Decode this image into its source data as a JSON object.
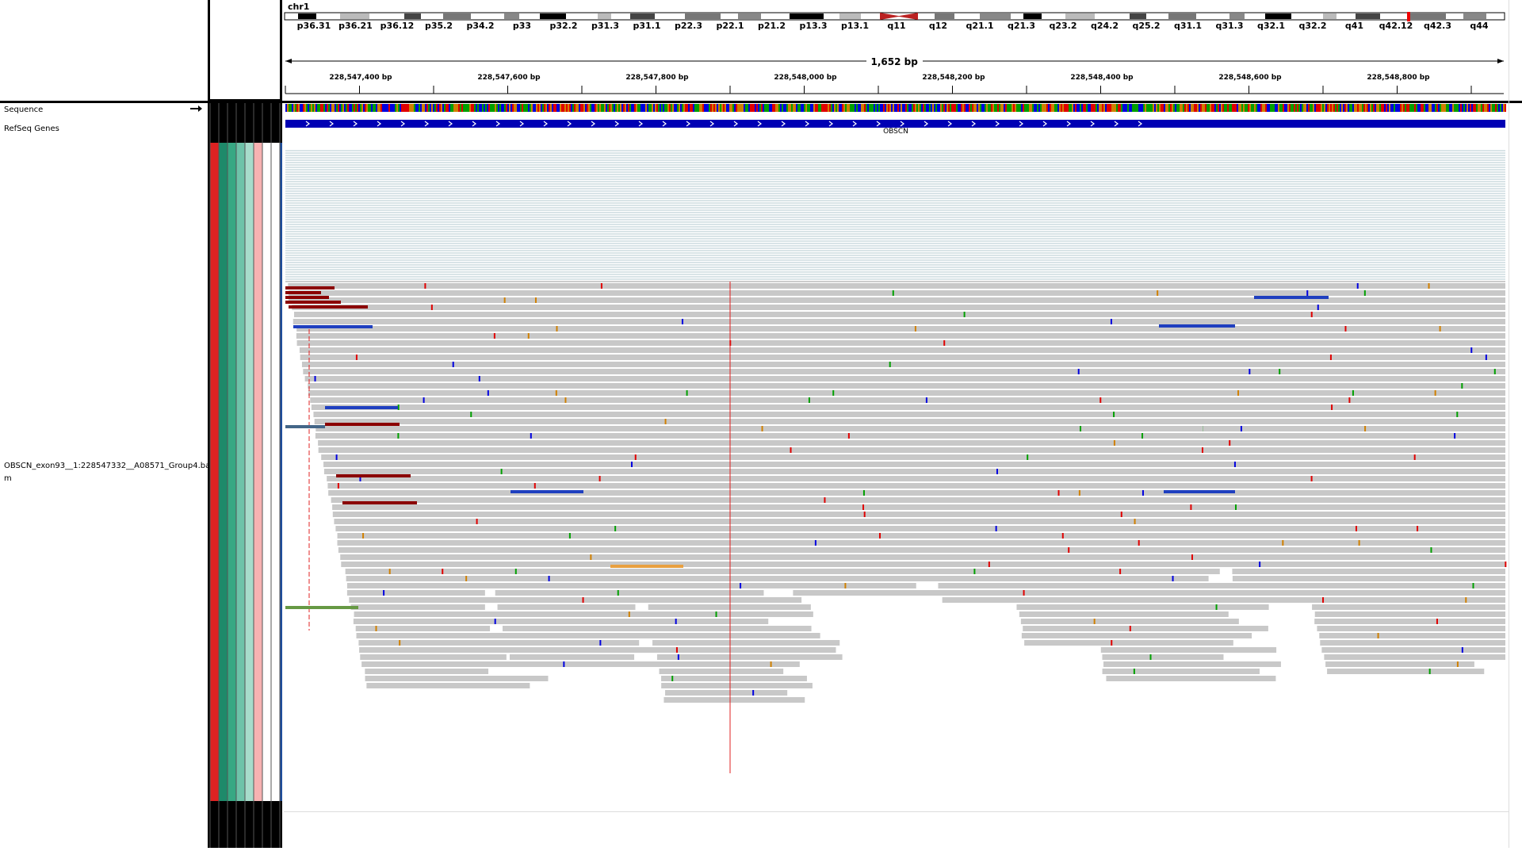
{
  "locus": {
    "chromosome": "chr1",
    "span_label": "1,652 bp"
  },
  "ideogram": {
    "bands": [
      "p36.31",
      "p36.21",
      "p36.12",
      "p35.2",
      "p34.2",
      "p33",
      "p32.2",
      "p31.3",
      "p31.1",
      "p22.3",
      "p22.1",
      "p21.2",
      "p13.3",
      "p13.1",
      "q11",
      "q12",
      "q21.1",
      "q21.3",
      "q23.2",
      "q24.2",
      "q25.2",
      "q31.1",
      "q31.3",
      "q32.1",
      "q32.2",
      "q41",
      "q42.12",
      "q42.3",
      "q44"
    ]
  },
  "ruler": {
    "ticks": [
      "228,547,400 bp",
      "228,547,600 bp",
      "228,547,800 bp",
      "228,548,000 bp",
      "228,548,200 bp",
      "228,548,400 bp",
      "228,548,600 bp",
      "228,548,800 bp"
    ]
  },
  "tracks": {
    "sequence": "Sequence",
    "refseq": "RefSeq Genes",
    "alignment_line1": "OBSCN_exon93__1:228547332__A08571_Group4.ba",
    "alignment_line2": "m"
  },
  "gene": {
    "name": "OBSCN"
  },
  "colors": {
    "gene": "#0000b4",
    "read": "#c8c8c8",
    "mismatch_line": "#e02020",
    "insert_large": "#8b0000",
    "insert_small": "#1f3fbf"
  },
  "attributes": {
    "colors": [
      "#dd2222",
      "#1e8a6a",
      "#37a883",
      "#6ec3a9",
      "#a7dccb",
      "#f7b2b2",
      "#ffffff",
      "#ffffff",
      "#1f4e9c"
    ]
  },
  "icons": {
    "sequence_arrow": "right-arrow-icon"
  }
}
